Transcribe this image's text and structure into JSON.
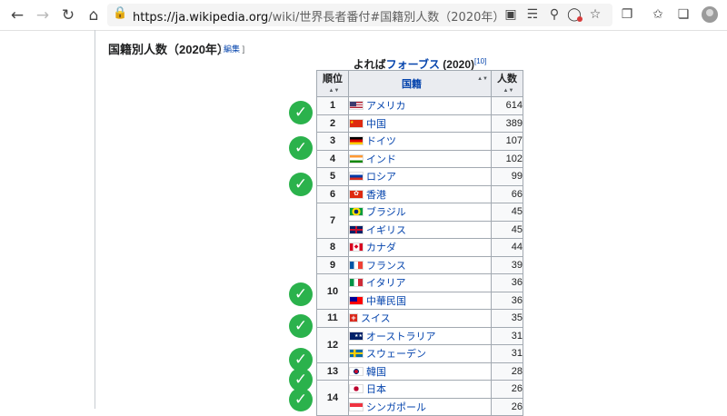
{
  "browser": {
    "url_host": "https://ja.wikipedia.org",
    "url_path": "/wiki/世界長者番付#国籍別人数（2020年）"
  },
  "section": {
    "title": "国籍別人数（2020年）",
    "edit_open": "[",
    "edit_label": "編集",
    "edit_close": "]"
  },
  "caption": {
    "prefix": "よれば",
    "link": "フォーブス",
    "suffix": "(2020)",
    "ref": "[10]"
  },
  "table": {
    "headers": [
      "順位",
      "国籍",
      "人数"
    ],
    "rows": [
      {
        "rank": "1",
        "country": "アメリカ",
        "count": "614"
      },
      {
        "rank": "2",
        "country": "中国",
        "count": "389"
      },
      {
        "rank": "3",
        "country": "ドイツ",
        "count": "107"
      },
      {
        "rank": "4",
        "country": "インド",
        "count": "102"
      },
      {
        "rank": "5",
        "country": "ロシア",
        "count": "99"
      },
      {
        "rank": "6",
        "country": "香港",
        "count": "66"
      },
      {
        "rank": "7",
        "country": "ブラジル",
        "count": "45"
      },
      {
        "rank": "",
        "country": "イギリス",
        "count": "45"
      },
      {
        "rank": "8",
        "country": "カナダ",
        "count": "44"
      },
      {
        "rank": "9",
        "country": "フランス",
        "count": "39"
      },
      {
        "rank": "10",
        "country": "イタリア",
        "count": "36"
      },
      {
        "rank": "",
        "country": "中華民国",
        "count": "36"
      },
      {
        "rank": "11",
        "country": "スイス",
        "count": "35"
      },
      {
        "rank": "12",
        "country": "オーストラリア",
        "count": "31"
      },
      {
        "rank": "",
        "country": "スウェーデン",
        "count": "31"
      },
      {
        "rank": "13",
        "country": "韓国",
        "count": "28"
      },
      {
        "rank": "14",
        "country": "日本",
        "count": "26"
      },
      {
        "rank": "",
        "country": "シンガポール",
        "count": "26"
      }
    ]
  },
  "colors": {
    "link": "#0645ad",
    "check": "#2bb24c"
  }
}
